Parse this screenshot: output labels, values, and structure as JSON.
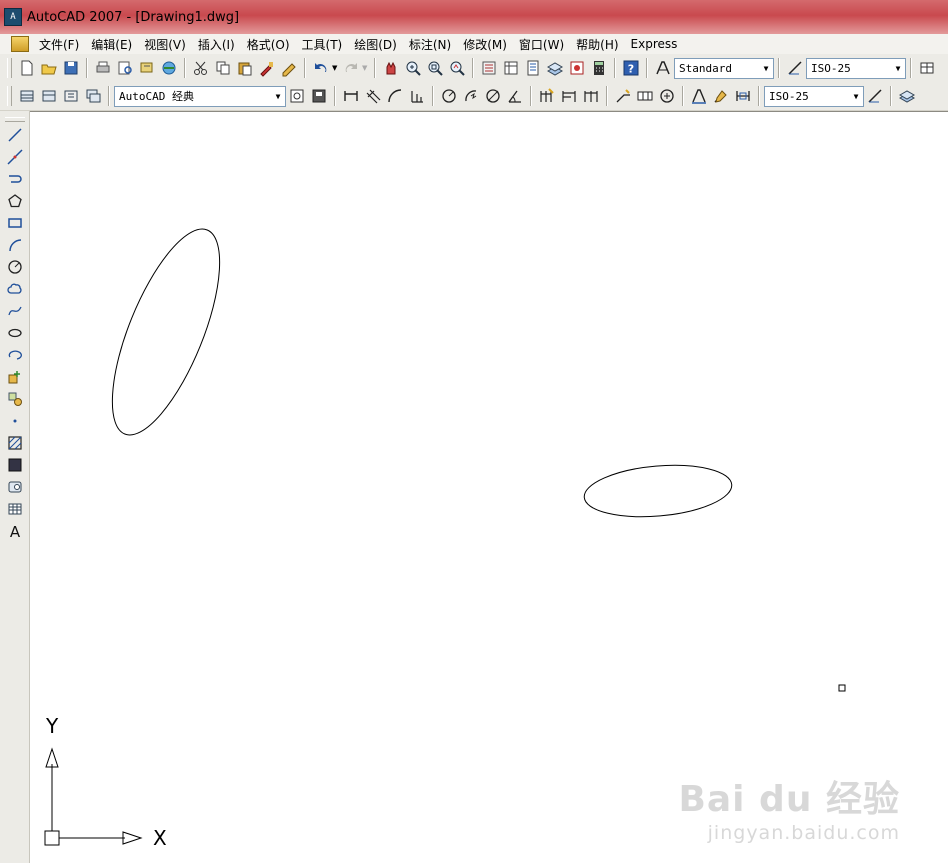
{
  "window": {
    "title": "AutoCAD 2007 - [Drawing1.dwg]",
    "app_icon_text": "A"
  },
  "menu": {
    "items": [
      "文件(F)",
      "编辑(E)",
      "视图(V)",
      "插入(I)",
      "格式(O)",
      "工具(T)",
      "绘图(D)",
      "标注(N)",
      "修改(M)",
      "窗口(W)",
      "帮助(H)",
      "Express"
    ]
  },
  "toolbar": {
    "text_style": "Standard",
    "dim_style": "ISO-25",
    "workspace": "AutoCAD 经典",
    "dim_style_2": "ISO-25"
  },
  "canvas": {
    "ucs_y_label": "Y",
    "ucs_x_label": "X"
  },
  "watermark": {
    "brand": "Bai du 经验",
    "url": "jingyan.baidu.com"
  },
  "colors": {
    "titlebar": "#c9494e",
    "toolbar_bg": "#ecebe6",
    "canvas_bg": "#ffffff"
  }
}
